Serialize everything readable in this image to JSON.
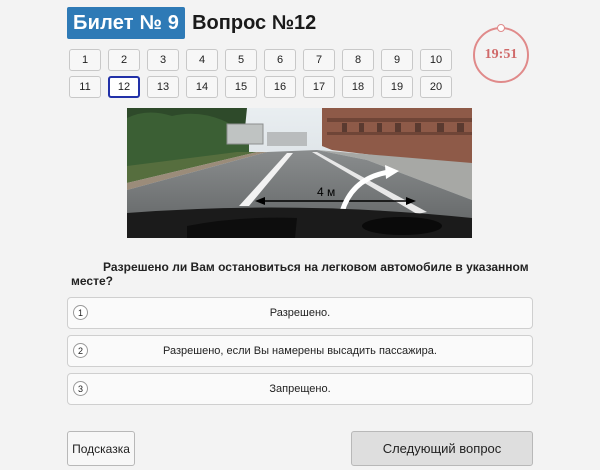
{
  "header": {
    "ticket_label": "Билет № 9",
    "question_label": "Вопрос №12"
  },
  "question_nav": {
    "active": "12",
    "items": [
      "1",
      "2",
      "3",
      "4",
      "5",
      "6",
      "7",
      "8",
      "9",
      "10",
      "11",
      "12",
      "13",
      "14",
      "15",
      "16",
      "17",
      "18",
      "19",
      "20"
    ]
  },
  "timer": {
    "value": "19:51"
  },
  "scene": {
    "distance_label": "4 м"
  },
  "question": {
    "text": "Разрешено ли Вам остановиться на легковом автомобиле в указанном месте?"
  },
  "answers": [
    {
      "num": "1",
      "text": "Разрешено."
    },
    {
      "num": "2",
      "text": "Разрешено, если Вы намерены высадить пассажира."
    },
    {
      "num": "3",
      "text": "Запрещено."
    }
  ],
  "buttons": {
    "hint": "Подсказка",
    "next": "Следующий вопрос"
  },
  "colors": {
    "badge": "#2e7ab6",
    "timer": "#e08a8a",
    "active_border": "#2231a8"
  }
}
